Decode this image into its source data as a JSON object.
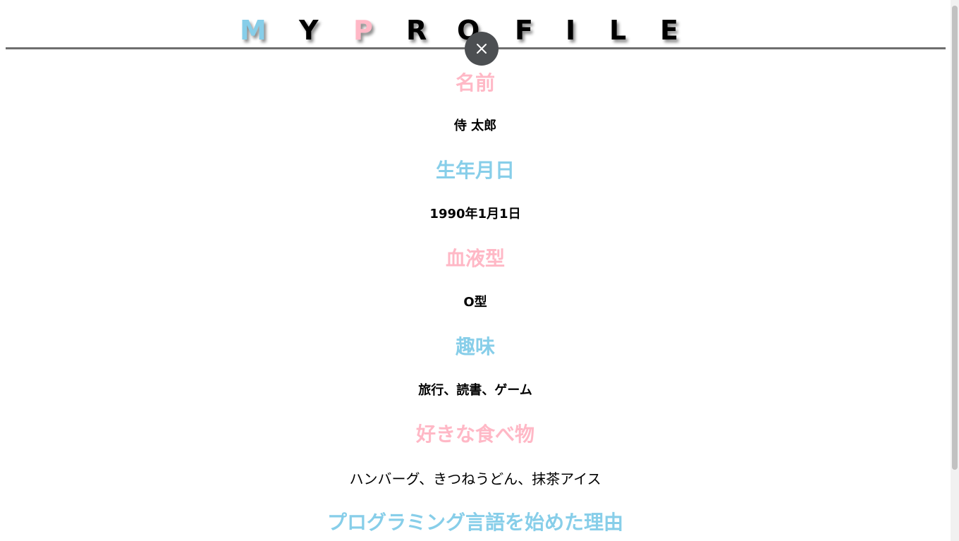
{
  "header": {
    "logo_letters": [
      "M",
      "Y",
      "P",
      "R",
      "O",
      "F",
      "I",
      "L",
      "E"
    ],
    "close_label": "×"
  },
  "profile": {
    "name_label": "名前",
    "name_value": "侍 太郎",
    "birthday_label": "生年月日",
    "birthday_value": "1990年1月1日",
    "blood_label": "血液型",
    "blood_value": "O型",
    "hobby_label": "趣味",
    "hobby_value": "旅行、読書、ゲーム",
    "food_label": "好きな食べ物",
    "food_value": "ハンバーグ、きつねうどん、抹茶アイス",
    "reason_label": "プログラミング言語を始めた理由"
  },
  "colors": {
    "pink": "#ffb8c6",
    "blue": "#87cee9",
    "rule": "#6e6e6e",
    "close_bg": "#4c4f52"
  }
}
